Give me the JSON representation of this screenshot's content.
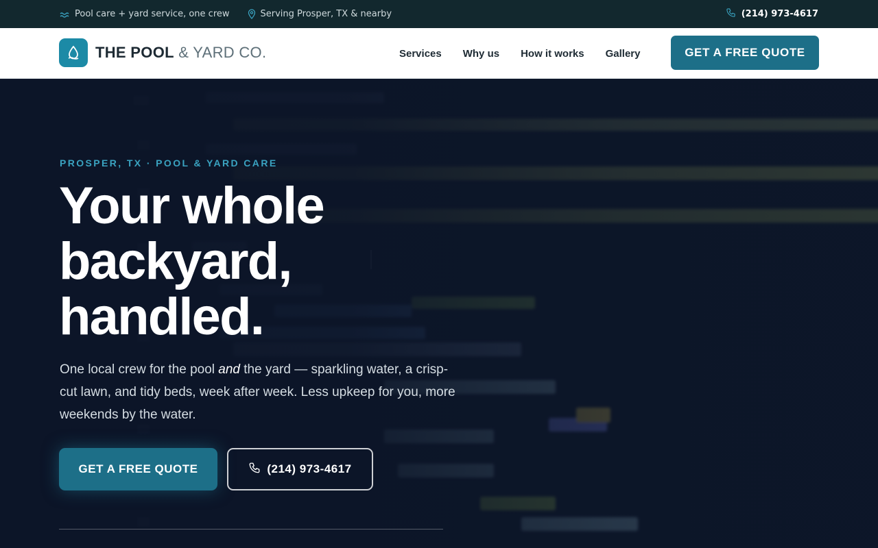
{
  "topbar": {
    "tagline": "Pool care + yard service, one crew",
    "location": "Serving Prosper, TX & nearby",
    "phone": "(214) 973-4617",
    "icons": [
      "waves-icon",
      "map-pin-icon",
      "phone-icon"
    ]
  },
  "brand": {
    "name_strong": "THE POOL",
    "name_light": "& YARD CO.",
    "logo_icon": "water-drop-icon",
    "accent_color": "#1c8aa6"
  },
  "nav": {
    "items": [
      "Services",
      "Why us",
      "How it works",
      "Gallery"
    ],
    "cta_label": "GET A FREE QUOTE"
  },
  "hero": {
    "eyebrow": "PROSPER, TX · POOL & YARD CARE",
    "headline_lines": [
      "Your whole",
      "backyard,",
      "handled."
    ],
    "subcopy_before": "One local crew for the pool ",
    "subcopy_em": "and",
    "subcopy_after": " the yard — sparkling water, a crisp-cut lawn, and tidy beds, week after week. Less upkeep for you, more weekends by the water.",
    "primary_cta": "GET A FREE QUOTE",
    "phone_cta": "(214) 973-4617"
  },
  "colors": {
    "topbar_bg": "#12282e",
    "button_bg": "#1d6f88",
    "eyebrow": "#3aa3c1",
    "hero_bg": "#0c1626"
  }
}
